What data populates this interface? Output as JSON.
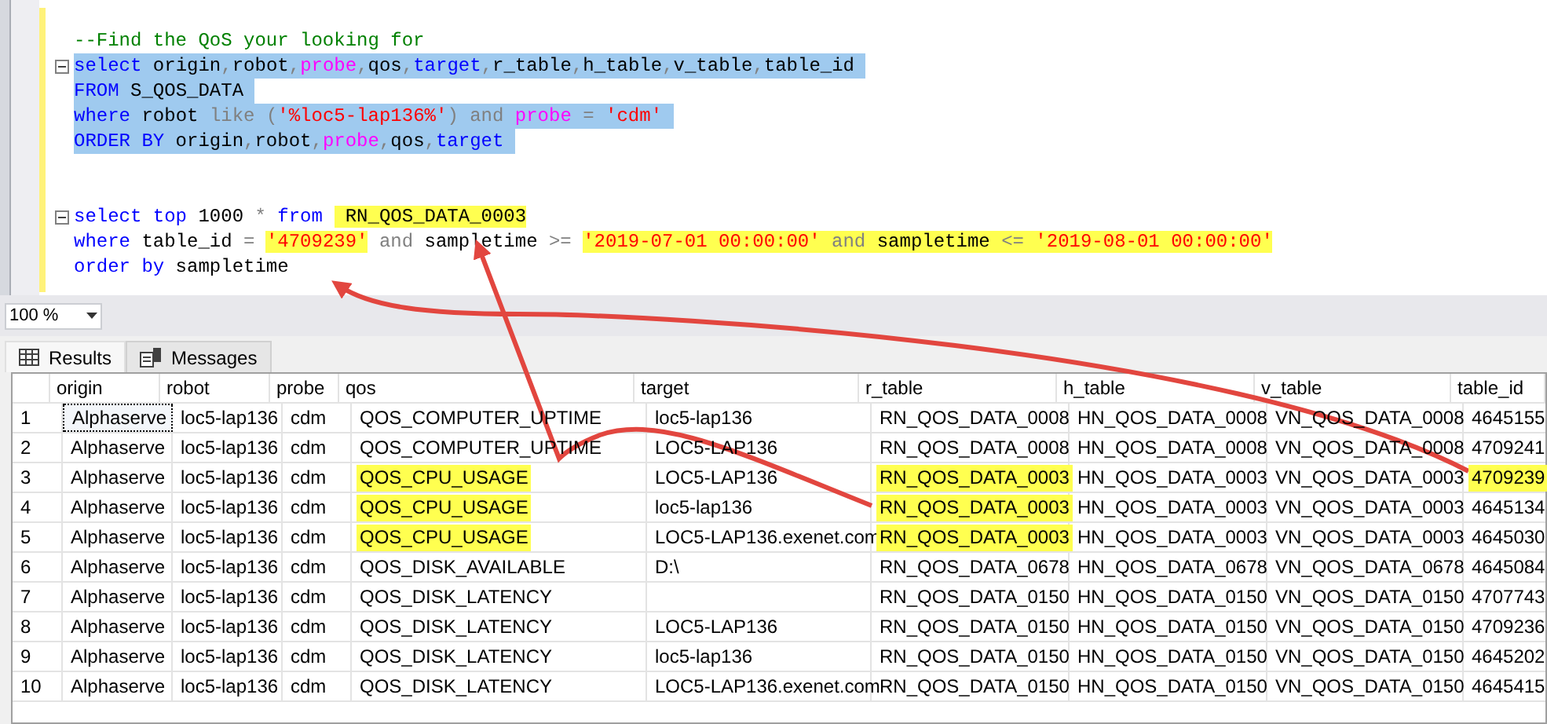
{
  "editor": {
    "lines": [
      {
        "kind": "code",
        "collapsible": false,
        "selected": false,
        "tokens": [
          {
            "text": "--Find the QoS your looking for",
            "kind": "comment",
            "highlighted": false
          }
        ]
      },
      {
        "kind": "code",
        "collapsible": true,
        "selected": true,
        "tokens": [
          {
            "text": "select",
            "kind": "keyword",
            "highlighted": false
          },
          {
            "text": " origin",
            "kind": "plain",
            "highlighted": false
          },
          {
            "text": ",",
            "kind": "operator",
            "highlighted": false
          },
          {
            "text": "robot",
            "kind": "plain",
            "highlighted": false
          },
          {
            "text": ",",
            "kind": "operator",
            "highlighted": false
          },
          {
            "text": "probe",
            "kind": "function",
            "highlighted": false
          },
          {
            "text": ",",
            "kind": "operator",
            "highlighted": false
          },
          {
            "text": "qos",
            "kind": "plain",
            "highlighted": false
          },
          {
            "text": ",",
            "kind": "operator",
            "highlighted": false
          },
          {
            "text": "target",
            "kind": "keyword",
            "highlighted": false
          },
          {
            "text": ",",
            "kind": "operator",
            "highlighted": false
          },
          {
            "text": "r_table",
            "kind": "plain",
            "highlighted": false
          },
          {
            "text": ",",
            "kind": "operator",
            "highlighted": false
          },
          {
            "text": "h_table",
            "kind": "plain",
            "highlighted": false
          },
          {
            "text": ",",
            "kind": "operator",
            "highlighted": false
          },
          {
            "text": "v_table",
            "kind": "plain",
            "highlighted": false
          },
          {
            "text": ",",
            "kind": "operator",
            "highlighted": false
          },
          {
            "text": "table_id",
            "kind": "plain",
            "highlighted": false
          }
        ]
      },
      {
        "kind": "code",
        "collapsible": false,
        "selected": true,
        "tokens": [
          {
            "text": "FROM",
            "kind": "keyword",
            "highlighted": false
          },
          {
            "text": " S_QOS_DATA",
            "kind": "plain",
            "highlighted": false
          }
        ]
      },
      {
        "kind": "code",
        "collapsible": false,
        "selected": true,
        "tokens": [
          {
            "text": "where",
            "kind": "keyword",
            "highlighted": false
          },
          {
            "text": " robot ",
            "kind": "plain",
            "highlighted": false
          },
          {
            "text": "like (",
            "kind": "operator",
            "highlighted": false
          },
          {
            "text": "'%loc5-lap136%'",
            "kind": "string",
            "highlighted": false
          },
          {
            "text": ") and ",
            "kind": "operator",
            "highlighted": false
          },
          {
            "text": "probe",
            "kind": "function",
            "highlighted": false
          },
          {
            "text": " = ",
            "kind": "operator",
            "highlighted": false
          },
          {
            "text": "'cdm'",
            "kind": "string",
            "highlighted": false
          }
        ]
      },
      {
        "kind": "code",
        "collapsible": false,
        "selected": true,
        "tokens": [
          {
            "text": "ORDER BY",
            "kind": "keyword",
            "highlighted": false
          },
          {
            "text": " origin",
            "kind": "plain",
            "highlighted": false
          },
          {
            "text": ",",
            "kind": "operator",
            "highlighted": false
          },
          {
            "text": "robot",
            "kind": "plain",
            "highlighted": false
          },
          {
            "text": ",",
            "kind": "operator",
            "highlighted": false
          },
          {
            "text": "probe",
            "kind": "function",
            "highlighted": false
          },
          {
            "text": ",",
            "kind": "operator",
            "highlighted": false
          },
          {
            "text": "qos",
            "kind": "plain",
            "highlighted": false
          },
          {
            "text": ",",
            "kind": "operator",
            "highlighted": false
          },
          {
            "text": "target",
            "kind": "keyword",
            "highlighted": false
          }
        ]
      },
      {
        "kind": "blank"
      },
      {
        "kind": "blank"
      },
      {
        "kind": "code",
        "collapsible": true,
        "selected": false,
        "tokens": [
          {
            "text": "select top ",
            "kind": "keyword",
            "highlighted": false
          },
          {
            "text": "1000 ",
            "kind": "plain",
            "highlighted": false
          },
          {
            "text": "* ",
            "kind": "operator",
            "highlighted": false
          },
          {
            "text": "from ",
            "kind": "keyword",
            "highlighted": false
          },
          {
            "text": " RN_QOS_DATA_0003",
            "kind": "plain",
            "highlighted": true
          }
        ]
      },
      {
        "kind": "code",
        "collapsible": false,
        "selected": false,
        "tokens": [
          {
            "text": "where",
            "kind": "keyword",
            "highlighted": false
          },
          {
            "text": " table_id ",
            "kind": "plain",
            "highlighted": false
          },
          {
            "text": "= ",
            "kind": "operator",
            "highlighted": false
          },
          {
            "text": "'4709239'",
            "kind": "string",
            "highlighted": true
          },
          {
            "text": " and ",
            "kind": "operator",
            "highlighted": false
          },
          {
            "text": "sampletime ",
            "kind": "plain",
            "highlighted": false
          },
          {
            "text": ">= ",
            "kind": "operator",
            "highlighted": false
          },
          {
            "text": "'2019-07-01 00:00:00'",
            "kind": "string",
            "highlighted": true
          },
          {
            "text": " and ",
            "kind": "operator",
            "highlighted": true
          },
          {
            "text": "sampletime ",
            "kind": "plain",
            "highlighted": true
          },
          {
            "text": "<= ",
            "kind": "operator",
            "highlighted": true
          },
          {
            "text": "'2019-08-01 00:00:00'",
            "kind": "string",
            "highlighted": true
          }
        ]
      },
      {
        "kind": "code",
        "collapsible": false,
        "selected": false,
        "tokens": [
          {
            "text": "order by",
            "kind": "keyword",
            "highlighted": false
          },
          {
            "text": " sampletime",
            "kind": "plain",
            "highlighted": false
          }
        ]
      }
    ]
  },
  "zoom": {
    "value": "100 %"
  },
  "result_tabs": [
    {
      "label": "Results",
      "kind": "grid",
      "selected": true
    },
    {
      "label": "Messages",
      "kind": "messages",
      "selected": false
    }
  ],
  "grid": {
    "columns": [
      "origin",
      "robot",
      "probe",
      "qos",
      "target",
      "r_table",
      "h_table",
      "v_table",
      "table_id"
    ],
    "rows": [
      {
        "number": "1",
        "cells": [
          {
            "text": "Alphaserve",
            "highlighted": false,
            "selected": true
          },
          {
            "text": "loc5-lap136",
            "highlighted": false,
            "selected": false
          },
          {
            "text": "cdm",
            "highlighted": false,
            "selected": false
          },
          {
            "text": "QOS_COMPUTER_UPTIME",
            "highlighted": false,
            "selected": false
          },
          {
            "text": "loc5-lap136",
            "highlighted": false,
            "selected": false
          },
          {
            "text": "RN_QOS_DATA_0008",
            "highlighted": false,
            "selected": false
          },
          {
            "text": "HN_QOS_DATA_0008",
            "highlighted": false,
            "selected": false
          },
          {
            "text": "VN_QOS_DATA_0008",
            "highlighted": false,
            "selected": false
          },
          {
            "text": "4645155",
            "highlighted": false,
            "selected": false
          }
        ]
      },
      {
        "number": "2",
        "cells": [
          {
            "text": "Alphaserve",
            "highlighted": false,
            "selected": false
          },
          {
            "text": "loc5-lap136",
            "highlighted": false,
            "selected": false
          },
          {
            "text": "cdm",
            "highlighted": false,
            "selected": false
          },
          {
            "text": "QOS_COMPUTER_UPTIME",
            "highlighted": false,
            "selected": false
          },
          {
            "text": "LOC5-LAP136",
            "highlighted": false,
            "selected": false
          },
          {
            "text": "RN_QOS_DATA_0008",
            "highlighted": false,
            "selected": false
          },
          {
            "text": "HN_QOS_DATA_0008",
            "highlighted": false,
            "selected": false
          },
          {
            "text": "VN_QOS_DATA_0008",
            "highlighted": false,
            "selected": false
          },
          {
            "text": "4709241",
            "highlighted": false,
            "selected": false
          }
        ]
      },
      {
        "number": "3",
        "cells": [
          {
            "text": "Alphaserve",
            "highlighted": false,
            "selected": false
          },
          {
            "text": "loc5-lap136",
            "highlighted": false,
            "selected": false
          },
          {
            "text": "cdm",
            "highlighted": false,
            "selected": false
          },
          {
            "text": "QOS_CPU_USAGE",
            "highlighted": true,
            "selected": false
          },
          {
            "text": "LOC5-LAP136",
            "highlighted": false,
            "selected": false
          },
          {
            "text": "RN_QOS_DATA_0003",
            "highlighted": true,
            "selected": false
          },
          {
            "text": "HN_QOS_DATA_0003",
            "highlighted": false,
            "selected": false
          },
          {
            "text": "VN_QOS_DATA_0003",
            "highlighted": false,
            "selected": false
          },
          {
            "text": "4709239",
            "highlighted": true,
            "selected": false
          }
        ]
      },
      {
        "number": "4",
        "cells": [
          {
            "text": "Alphaserve",
            "highlighted": false,
            "selected": false
          },
          {
            "text": "loc5-lap136",
            "highlighted": false,
            "selected": false
          },
          {
            "text": "cdm",
            "highlighted": false,
            "selected": false
          },
          {
            "text": "QOS_CPU_USAGE",
            "highlighted": true,
            "selected": false
          },
          {
            "text": "loc5-lap136",
            "highlighted": false,
            "selected": false
          },
          {
            "text": "RN_QOS_DATA_0003",
            "highlighted": true,
            "selected": false
          },
          {
            "text": "HN_QOS_DATA_0003",
            "highlighted": false,
            "selected": false
          },
          {
            "text": "VN_QOS_DATA_0003",
            "highlighted": false,
            "selected": false
          },
          {
            "text": "4645134",
            "highlighted": false,
            "selected": false
          }
        ]
      },
      {
        "number": "5",
        "cells": [
          {
            "text": "Alphaserve",
            "highlighted": false,
            "selected": false
          },
          {
            "text": "loc5-lap136",
            "highlighted": false,
            "selected": false
          },
          {
            "text": "cdm",
            "highlighted": false,
            "selected": false
          },
          {
            "text": "QOS_CPU_USAGE",
            "highlighted": true,
            "selected": false
          },
          {
            "text": "LOC5-LAP136.exenet.com",
            "highlighted": false,
            "selected": false
          },
          {
            "text": "RN_QOS_DATA_0003",
            "highlighted": true,
            "selected": false
          },
          {
            "text": "HN_QOS_DATA_0003",
            "highlighted": false,
            "selected": false
          },
          {
            "text": "VN_QOS_DATA_0003",
            "highlighted": false,
            "selected": false
          },
          {
            "text": "4645030",
            "highlighted": false,
            "selected": false
          }
        ]
      },
      {
        "number": "6",
        "cells": [
          {
            "text": "Alphaserve",
            "highlighted": false,
            "selected": false
          },
          {
            "text": "loc5-lap136",
            "highlighted": false,
            "selected": false
          },
          {
            "text": "cdm",
            "highlighted": false,
            "selected": false
          },
          {
            "text": "QOS_DISK_AVAILABLE",
            "highlighted": false,
            "selected": false
          },
          {
            "text": "D:\\",
            "highlighted": false,
            "selected": false
          },
          {
            "text": "RN_QOS_DATA_0678",
            "highlighted": false,
            "selected": false
          },
          {
            "text": "HN_QOS_DATA_0678",
            "highlighted": false,
            "selected": false
          },
          {
            "text": "VN_QOS_DATA_0678",
            "highlighted": false,
            "selected": false
          },
          {
            "text": "4645084",
            "highlighted": false,
            "selected": false
          }
        ]
      },
      {
        "number": "7",
        "cells": [
          {
            "text": "Alphaserve",
            "highlighted": false,
            "selected": false
          },
          {
            "text": "loc5-lap136",
            "highlighted": false,
            "selected": false
          },
          {
            "text": "cdm",
            "highlighted": false,
            "selected": false
          },
          {
            "text": "QOS_DISK_LATENCY",
            "highlighted": false,
            "selected": false
          },
          null,
          {
            "text": "RN_QOS_DATA_0150",
            "highlighted": false,
            "selected": false
          },
          {
            "text": "HN_QOS_DATA_0150",
            "highlighted": false,
            "selected": false
          },
          {
            "text": "VN_QOS_DATA_0150",
            "highlighted": false,
            "selected": false
          },
          {
            "text": "4707743",
            "highlighted": false,
            "selected": false
          }
        ]
      },
      {
        "number": "8",
        "cells": [
          {
            "text": "Alphaserve",
            "highlighted": false,
            "selected": false
          },
          {
            "text": "loc5-lap136",
            "highlighted": false,
            "selected": false
          },
          {
            "text": "cdm",
            "highlighted": false,
            "selected": false
          },
          {
            "text": "QOS_DISK_LATENCY",
            "highlighted": false,
            "selected": false
          },
          {
            "text": "LOC5-LAP136",
            "highlighted": false,
            "selected": false
          },
          {
            "text": "RN_QOS_DATA_0150",
            "highlighted": false,
            "selected": false
          },
          {
            "text": "HN_QOS_DATA_0150",
            "highlighted": false,
            "selected": false
          },
          {
            "text": "VN_QOS_DATA_0150",
            "highlighted": false,
            "selected": false
          },
          {
            "text": "4709236",
            "highlighted": false,
            "selected": false
          }
        ]
      },
      {
        "number": "9",
        "cells": [
          {
            "text": "Alphaserve",
            "highlighted": false,
            "selected": false
          },
          {
            "text": "loc5-lap136",
            "highlighted": false,
            "selected": false
          },
          {
            "text": "cdm",
            "highlighted": false,
            "selected": false
          },
          {
            "text": "QOS_DISK_LATENCY",
            "highlighted": false,
            "selected": false
          },
          {
            "text": "loc5-lap136",
            "highlighted": false,
            "selected": false
          },
          {
            "text": "RN_QOS_DATA_0150",
            "highlighted": false,
            "selected": false
          },
          {
            "text": "HN_QOS_DATA_0150",
            "highlighted": false,
            "selected": false
          },
          {
            "text": "VN_QOS_DATA_0150",
            "highlighted": false,
            "selected": false
          },
          {
            "text": "4645202",
            "highlighted": false,
            "selected": false
          }
        ]
      },
      {
        "number": "10",
        "cells": [
          {
            "text": "Alphaserve",
            "highlighted": false,
            "selected": false
          },
          {
            "text": "loc5-lap136",
            "highlighted": false,
            "selected": false
          },
          {
            "text": "cdm",
            "highlighted": false,
            "selected": false
          },
          {
            "text": "QOS_DISK_LATENCY",
            "highlighted": false,
            "selected": false
          },
          {
            "text": "LOC5-LAP136.exenet.com",
            "highlighted": false,
            "selected": false
          },
          {
            "text": "RN_QOS_DATA_0150",
            "highlighted": false,
            "selected": false
          },
          {
            "text": "HN_QOS_DATA_0150",
            "highlighted": false,
            "selected": false
          },
          {
            "text": "VN_QOS_DATA_0150",
            "highlighted": false,
            "selected": false
          },
          {
            "text": "4645415",
            "highlighted": false,
            "selected": false
          }
        ]
      }
    ]
  }
}
